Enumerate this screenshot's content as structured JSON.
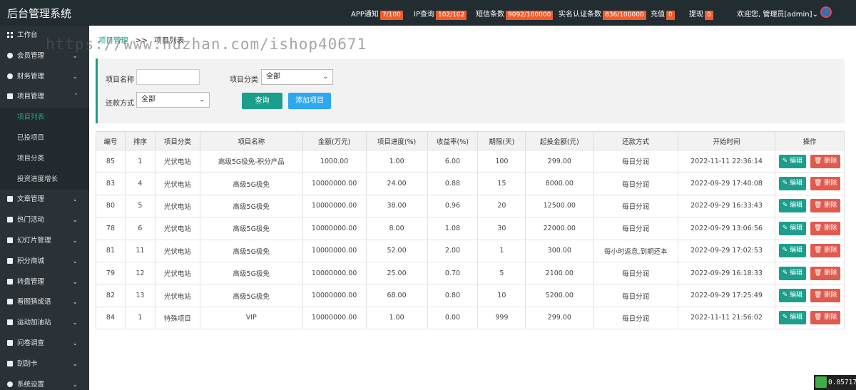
{
  "header": {
    "brand": "后台管理系统",
    "stats": [
      {
        "label": "APP通知",
        "badge": "7/100"
      },
      {
        "label": "IP查询",
        "badge": "102/102"
      },
      {
        "label": "短信条数",
        "badge": "9092/100000"
      },
      {
        "label": "实名认证条数",
        "badge": "836/100000"
      },
      {
        "label": "充值",
        "badge": "0"
      },
      {
        "label": "提现",
        "badge": "0"
      }
    ],
    "user": "欢迎您, 管理员[admin]"
  },
  "sidebar": {
    "items": [
      {
        "label": "工作台"
      },
      {
        "label": "会员管理"
      },
      {
        "label": "财务管理"
      },
      {
        "label": "项目管理"
      },
      {
        "label": "文章管理"
      },
      {
        "label": "热门活动"
      },
      {
        "label": "幻灯片管理"
      },
      {
        "label": "积分商城"
      },
      {
        "label": "转盘管理"
      },
      {
        "label": "看图猜成语"
      },
      {
        "label": "运动加油站"
      },
      {
        "label": "问卷调查"
      },
      {
        "label": "刮刮卡"
      },
      {
        "label": "系统设置"
      }
    ],
    "sub_items": [
      {
        "label": "项目列表"
      },
      {
        "label": "已投项目"
      },
      {
        "label": "项目分类"
      },
      {
        "label": "投资进度增长"
      }
    ]
  },
  "breadcrumb": {
    "parent": "项目管理",
    "sep": ">>",
    "current": "项目列表"
  },
  "watermark": "https://www.huzhan.com/ishop40671",
  "filter": {
    "name_label": "项目名称",
    "name_value": "",
    "category_label": "项目分类",
    "category_value": "全部",
    "repay_label": "还款方式",
    "repay_value": "全部",
    "search_button": "查询",
    "add_button": "添加项目"
  },
  "table": {
    "columns": [
      "编号",
      "排序",
      "项目分类",
      "项目名称",
      "金额(万元)",
      "项目进度(%)",
      "收益率(%)",
      "期限(天)",
      "起投金额(元)",
      "还款方式",
      "开始时间",
      "操作"
    ],
    "edit_label": "编辑",
    "delete_label": "删除",
    "rows": [
      [
        "85",
        "1",
        "光伏电站",
        "高级5G极免-积分产品",
        "1000.00",
        "1.00",
        "6.00",
        "100",
        "299.00",
        "每日分润",
        "2022-11-11 22:36:14"
      ],
      [
        "83",
        "4",
        "光伏电站",
        "高级5G极免",
        "10000000.00",
        "24.00",
        "0.88",
        "15",
        "8000.00",
        "每日分润",
        "2022-09-29 17:40:08"
      ],
      [
        "80",
        "5",
        "光伏电站",
        "高级5G极免",
        "10000000.00",
        "38.00",
        "0.96",
        "20",
        "12500.00",
        "每日分润",
        "2022-09-29 16:33:43"
      ],
      [
        "78",
        "6",
        "光伏电站",
        "高级5G极免",
        "10000000.00",
        "8.00",
        "1.08",
        "30",
        "22000.00",
        "每日分润",
        "2022-09-29 13:06:56"
      ],
      [
        "81",
        "11",
        "光伏电站",
        "高级5G极免",
        "10000000.00",
        "52.00",
        "2.00",
        "1",
        "300.00",
        "每小时返息,到期还本",
        "2022-09-29 17:02:53"
      ],
      [
        "79",
        "12",
        "光伏电站",
        "高级5G极免",
        "10000000.00",
        "25.00",
        "0.70",
        "5",
        "2100.00",
        "每日分润",
        "2022-09-29 16:18:33"
      ],
      [
        "82",
        "13",
        "光伏电站",
        "高级5G极免",
        "10000000.00",
        "68.00",
        "0.80",
        "10",
        "5200.00",
        "每日分润",
        "2022-09-29 17:25:49"
      ],
      [
        "84",
        "1",
        "特殊项目",
        "VIP",
        "10000000.00",
        "1.00",
        "0.00",
        "999",
        "299.00",
        "每日分润",
        "2022-11-11 21:56:02"
      ]
    ]
  },
  "timer": "0.057174"
}
